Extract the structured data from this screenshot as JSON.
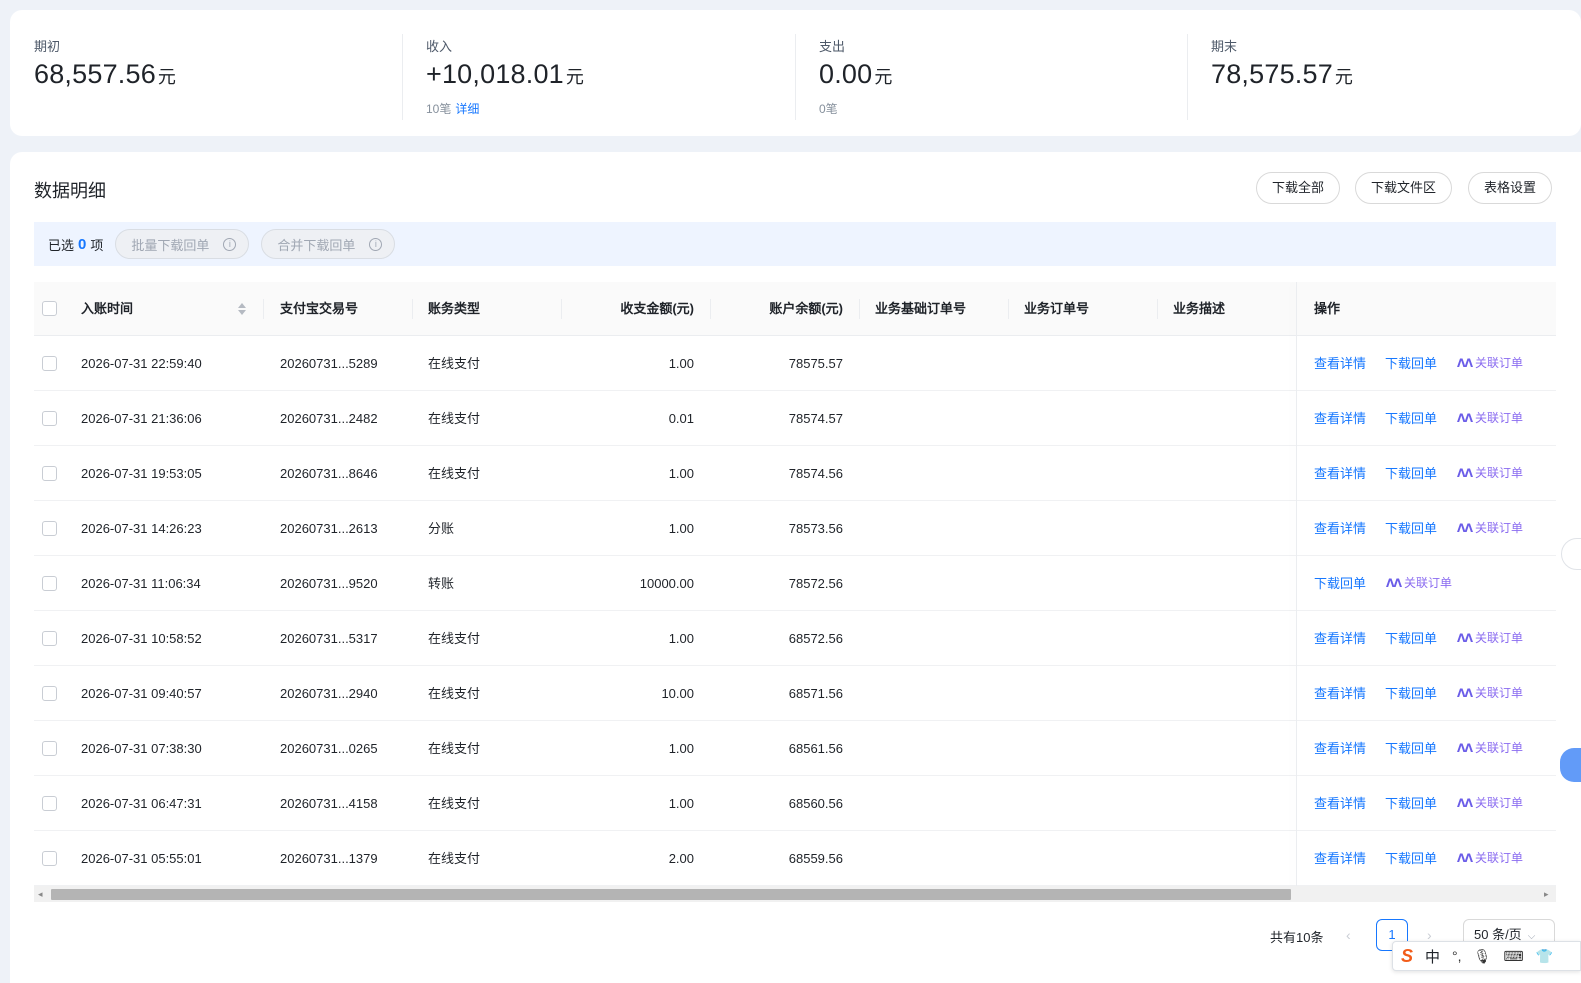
{
  "summary": {
    "opening": {
      "label": "期初",
      "value": "68,557.56",
      "unit": "元"
    },
    "income": {
      "label": "收入",
      "value": "+10,018.01",
      "unit": "元",
      "count": "10笔",
      "detail_link": "详细"
    },
    "expense": {
      "label": "支出",
      "value": "0.00",
      "unit": "元",
      "count": "0笔"
    },
    "closing": {
      "label": "期末",
      "value": "78,575.57",
      "unit": "元"
    }
  },
  "detail": {
    "title": "数据明细",
    "buttons": {
      "download_all": "下载全部",
      "download_area": "下载文件区",
      "table_settings": "表格设置"
    }
  },
  "selection": {
    "prefix": "已选",
    "count": "0",
    "suffix": "项",
    "batch_download": "批量下载回单",
    "merge_download": "合并下载回单",
    "info_glyph": "i"
  },
  "table": {
    "columns": {
      "time": "入账时间",
      "trade_no": "支付宝交易号",
      "type": "账务类型",
      "amount": "收支金额(元)",
      "balance": "账户余额(元)",
      "base_order": "业务基础订单号",
      "order": "业务订单号",
      "desc": "业务描述",
      "ops": "操作"
    },
    "op_labels": {
      "view": "查看详情",
      "download": "下载回单",
      "link_order": "关联订单",
      "ai_glyph": "ᐱᐱ"
    },
    "rows": [
      {
        "time": "2026-07-31 22:59:40",
        "trade_no": "20260731...5289",
        "type": "在线支付",
        "amount": "1.00",
        "balance": "78575.57",
        "has_view": true
      },
      {
        "time": "2026-07-31 21:36:06",
        "trade_no": "20260731...2482",
        "type": "在线支付",
        "amount": "0.01",
        "balance": "78574.57",
        "has_view": true
      },
      {
        "time": "2026-07-31 19:53:05",
        "trade_no": "20260731...8646",
        "type": "在线支付",
        "amount": "1.00",
        "balance": "78574.56",
        "has_view": true
      },
      {
        "time": "2026-07-31 14:26:23",
        "trade_no": "20260731...2613",
        "type": "分账",
        "amount": "1.00",
        "balance": "78573.56",
        "has_view": true
      },
      {
        "time": "2026-07-31 11:06:34",
        "trade_no": "20260731...9520",
        "type": "转账",
        "amount": "10000.00",
        "balance": "78572.56",
        "has_view": false
      },
      {
        "time": "2026-07-31 10:58:52",
        "trade_no": "20260731...5317",
        "type": "在线支付",
        "amount": "1.00",
        "balance": "68572.56",
        "has_view": true
      },
      {
        "time": "2026-07-31 09:40:57",
        "trade_no": "20260731...2940",
        "type": "在线支付",
        "amount": "10.00",
        "balance": "68571.56",
        "has_view": true
      },
      {
        "time": "2026-07-31 07:38:30",
        "trade_no": "20260731...0265",
        "type": "在线支付",
        "amount": "1.00",
        "balance": "68561.56",
        "has_view": true
      },
      {
        "time": "2026-07-31 06:47:31",
        "trade_no": "20260731...4158",
        "type": "在线支付",
        "amount": "1.00",
        "balance": "68560.56",
        "has_view": true
      },
      {
        "time": "2026-07-31 05:55:01",
        "trade_no": "20260731...1379",
        "type": "在线支付",
        "amount": "2.00",
        "balance": "68559.56",
        "has_view": true
      }
    ]
  },
  "pagination": {
    "total": "共有10条",
    "current": "1",
    "page_size": "50 条/页",
    "prev": "‹",
    "next": "›",
    "size_chevron": "⌵"
  },
  "scrollbar": {
    "left_arrow": "◂",
    "right_arrow": "▸"
  },
  "ime": {
    "logo": "S",
    "mode": "中",
    "punct": "°,",
    "mic": "🎙",
    "keyboard": "⌨",
    "skin": "👕"
  },
  "colors": {
    "link": "#1677ff",
    "ai": "#8b6cf0",
    "background": "#eef2f8"
  }
}
